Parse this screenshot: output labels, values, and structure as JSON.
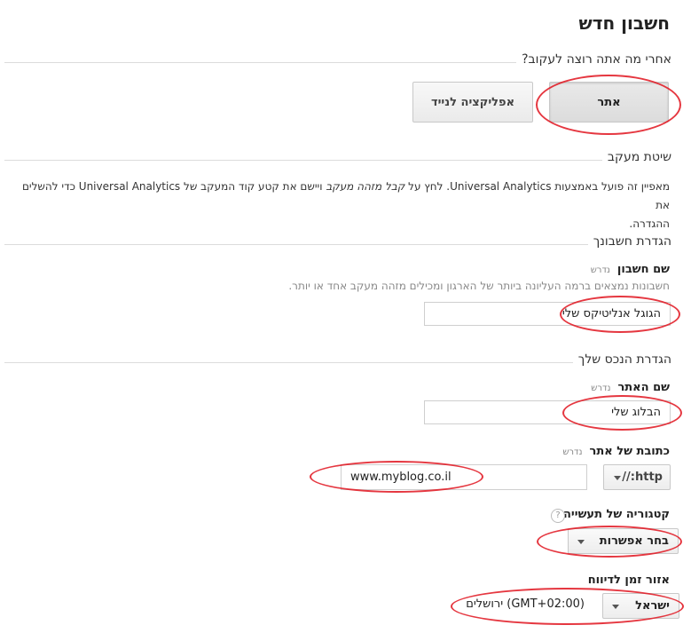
{
  "page": {
    "title": "חשבון חדש"
  },
  "track": {
    "question": "אחרי מה אתה רוצה לעקוב?",
    "option_website": "אתר",
    "option_mobile": "אפליקציה לנייד"
  },
  "tracking_method": {
    "heading": "שיטת מעקב",
    "description_1": "מאפיין זה פועל באמצעות Universal Analytics. לחץ על ",
    "description_italic": "קבל מזהה מעקב",
    "description_2": " ויישם את קטע קוד המעקב של Universal Analytics כדי להשלים את",
    "description_3": "ההגדרה."
  },
  "account_setup": {
    "heading": "הגדרת חשבונך",
    "name_label": "שם חשבון",
    "required": "נדרש",
    "hint": "חשבונות נמצאים ברמה העליונה ביותר של הארגון ומכילים מזהה מעקב אחד או יותר.",
    "name_value": "הגוגל אנליטיקס שלי"
  },
  "property_setup": {
    "heading": "הגדרת הנכס שלך",
    "site_name_label": "שם האתר",
    "site_name_required": "נדרש",
    "site_name_value": "הבלוג שלי",
    "url_label": "כתובת של אתר",
    "url_required": "נדרש",
    "protocol_value": "http://",
    "url_value": "www.myblog.co.il",
    "category_label": "קטגוריה של תעשייה:",
    "help_icon": "?",
    "category_value": "בחר אפשרות",
    "timezone_label": "אזור זמן לדיווח",
    "country_value": "ישראל",
    "timezone_value": "(GMT+02:00) ירושלים"
  },
  "annotation_color": "#e0141e"
}
